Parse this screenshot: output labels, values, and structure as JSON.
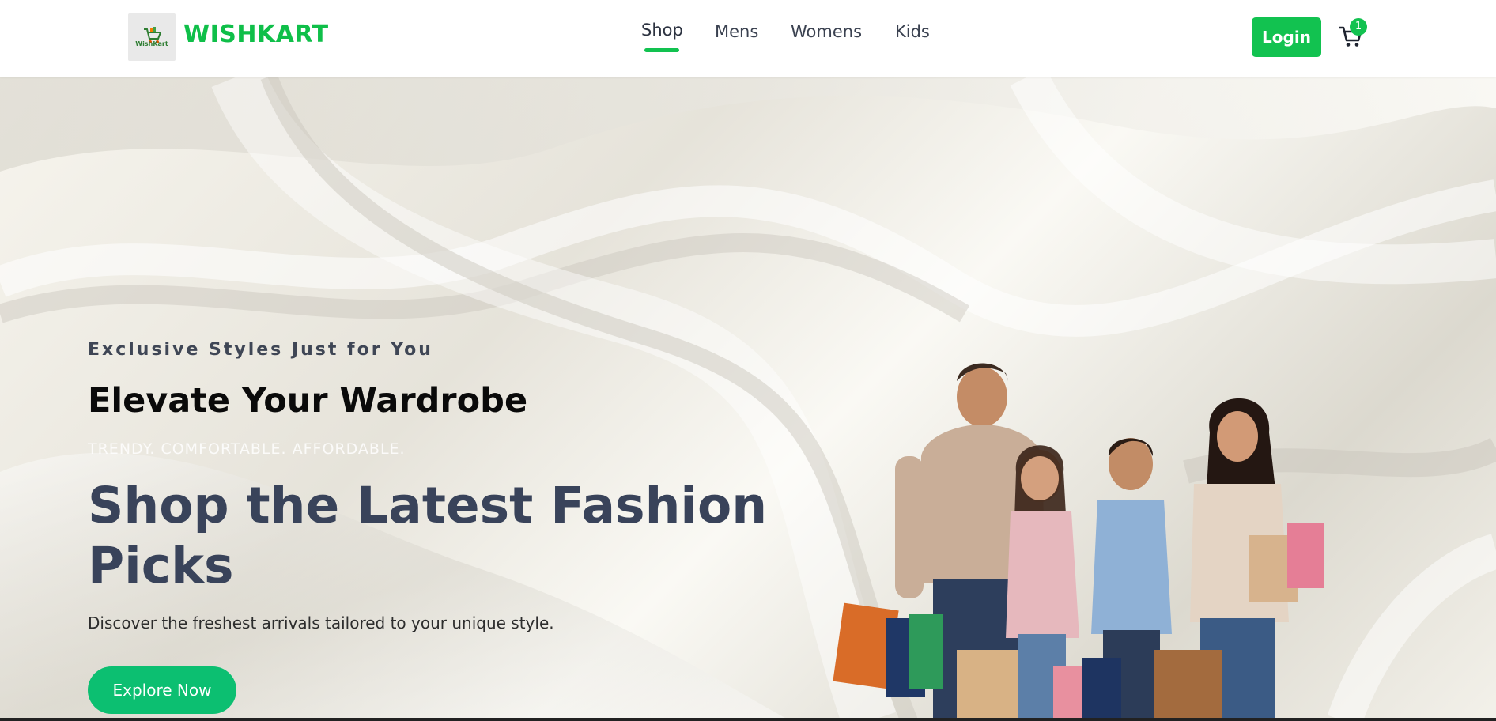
{
  "header": {
    "logo_text": "WishKart",
    "brand": "WISHKART",
    "nav": [
      {
        "label": "Shop",
        "active": true
      },
      {
        "label": "Mens",
        "active": false
      },
      {
        "label": "Womens",
        "active": false
      },
      {
        "label": "Kids",
        "active": false
      }
    ],
    "login_label": "Login",
    "cart_count": "1",
    "accent_color": "#12c250"
  },
  "hero": {
    "eyebrow": "Exclusive Styles Just for You",
    "headline": "Elevate Your Wardrobe",
    "tagline": "TRENDY. COMFORTABLE. AFFORDABLE.",
    "title": "Shop the Latest Fashion Picks",
    "description": "Discover the freshest arrivals tailored to your unique style.",
    "cta_label": "Explore Now",
    "cta_color": "#0cbf71",
    "image": "family-with-shopping-bags"
  }
}
